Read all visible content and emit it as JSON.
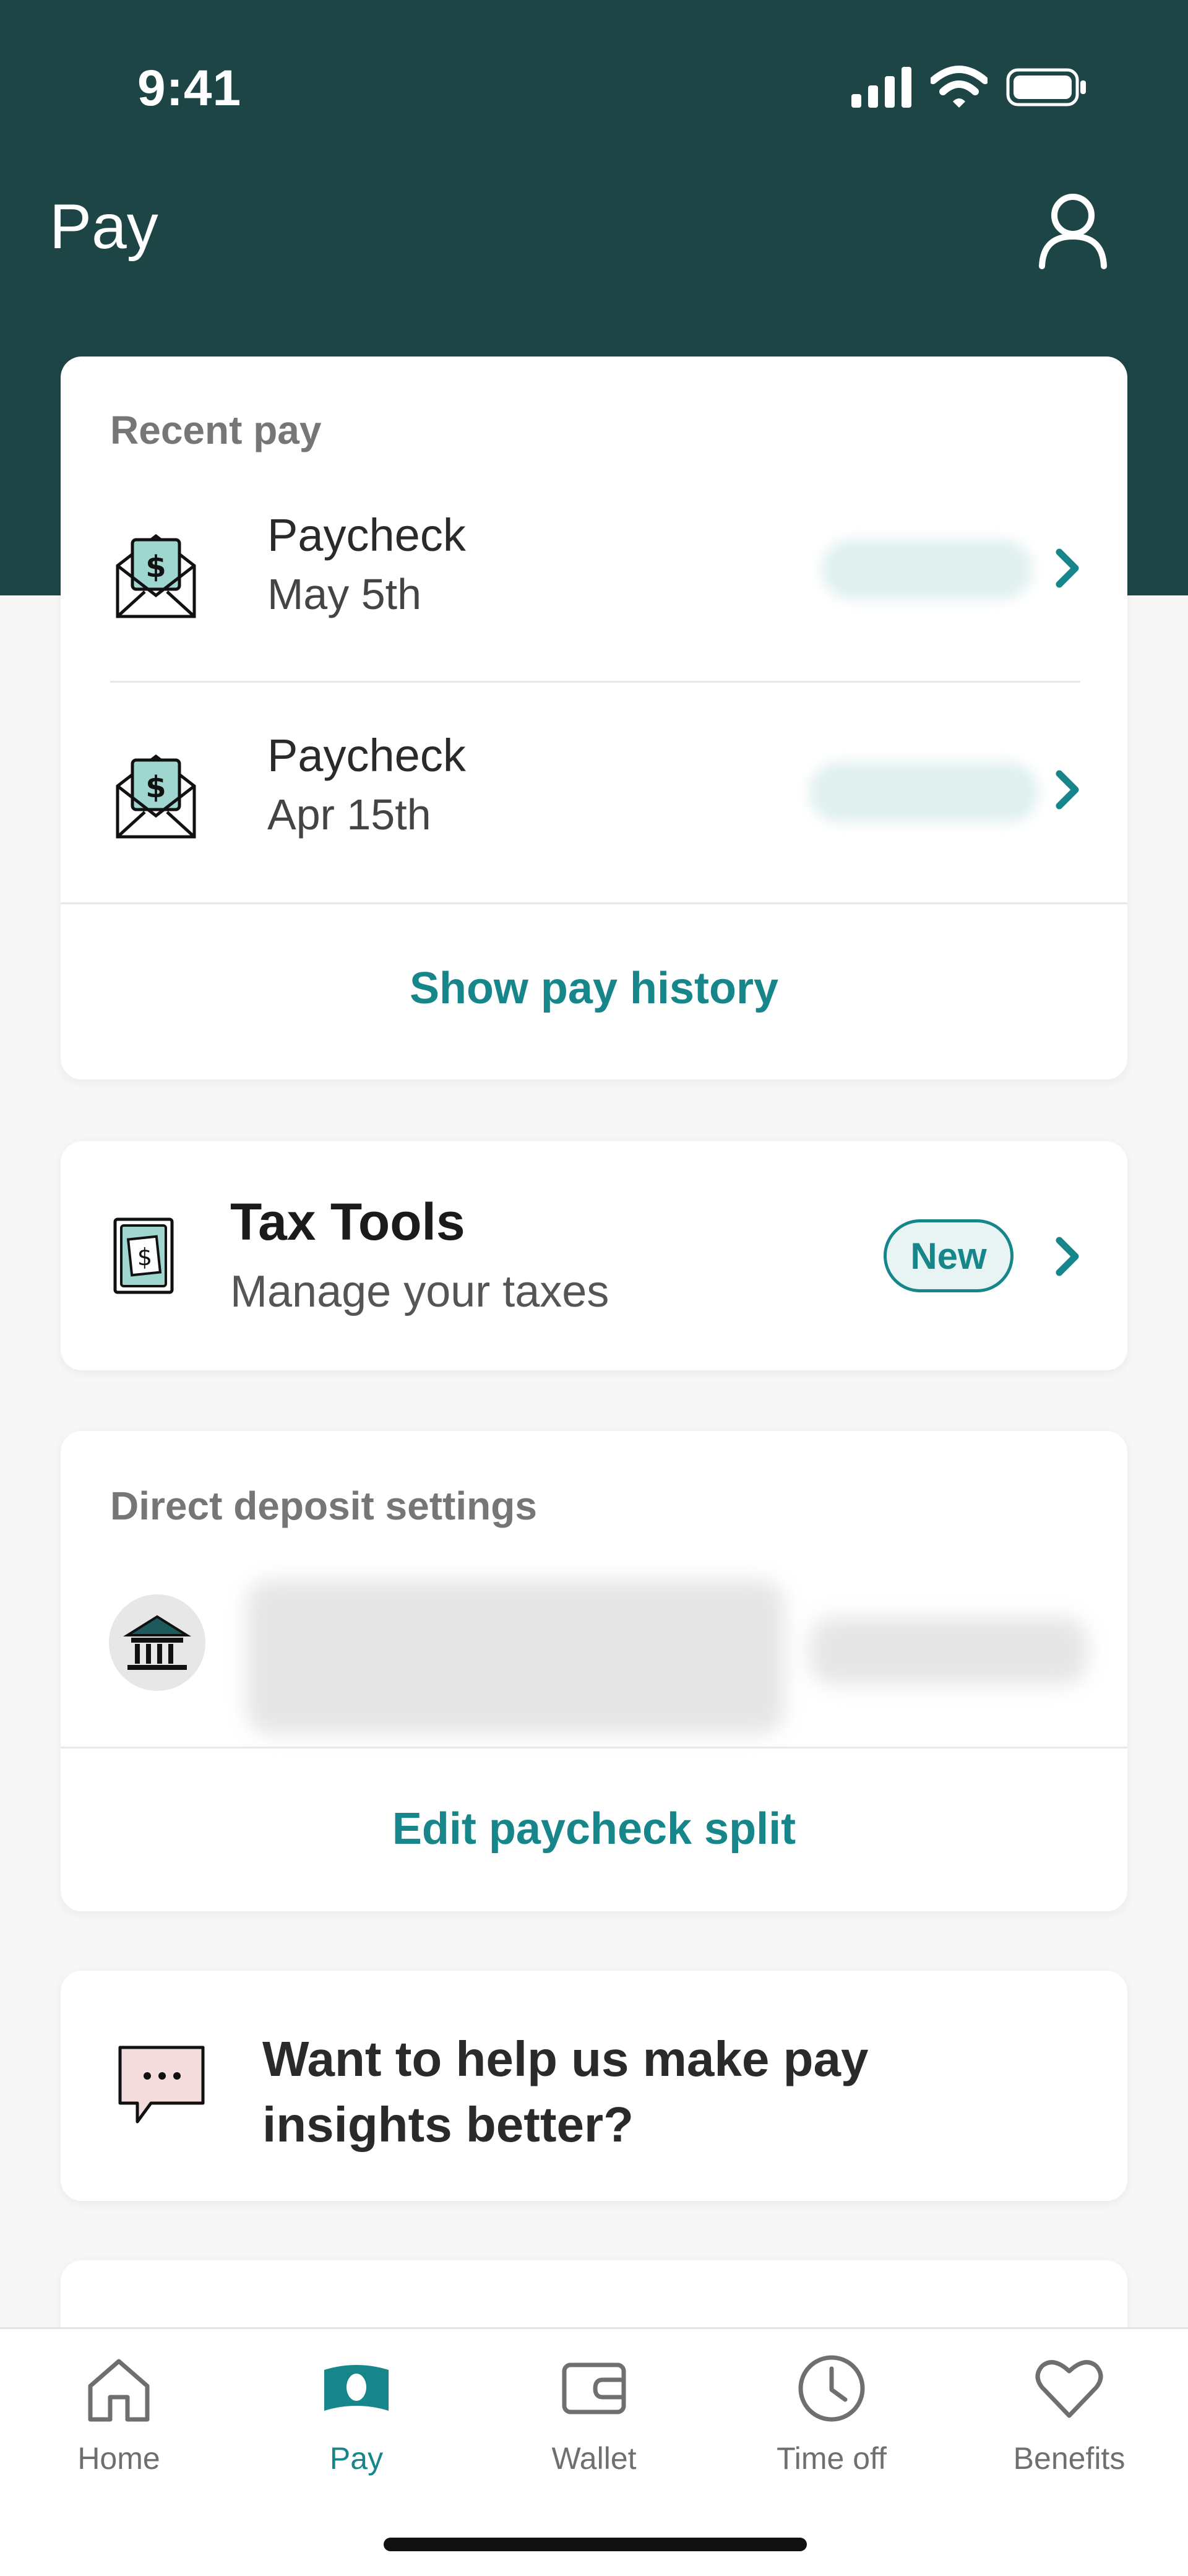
{
  "status": {
    "time": "9:41"
  },
  "header": {
    "title": "Pay",
    "profile_icon": "user-profile-icon"
  },
  "recent_pay": {
    "label": "Recent pay",
    "items": [
      {
        "title": "Paycheck",
        "date": "May 5th",
        "icon": "envelope-dollar-icon"
      },
      {
        "title": "Paycheck",
        "date": "Apr 15th",
        "icon": "envelope-dollar-icon"
      }
    ],
    "show_history_label": "Show pay history"
  },
  "tax_tools": {
    "title": "Tax Tools",
    "subtitle": "Manage your taxes",
    "badge": "New",
    "icon": "tax-document-icon"
  },
  "direct_deposit": {
    "label": "Direct deposit settings",
    "icon": "bank-icon",
    "edit_label": "Edit paycheck split"
  },
  "insights": {
    "text": "Want to help us make pay insights better?",
    "icon": "chat-bubble-icon"
  },
  "tabs": [
    {
      "label": "Home",
      "icon": "home-icon",
      "active": false
    },
    {
      "label": "Pay",
      "icon": "pay-icon",
      "active": true
    },
    {
      "label": "Wallet",
      "icon": "wallet-icon",
      "active": false
    },
    {
      "label": "Time off",
      "icon": "clock-icon",
      "active": false
    },
    {
      "label": "Benefits",
      "icon": "heart-icon",
      "active": false
    }
  ],
  "colors": {
    "header": "#1e4546",
    "accent": "#17868a",
    "background": "#f7f7f7",
    "card": "#ffffff"
  }
}
